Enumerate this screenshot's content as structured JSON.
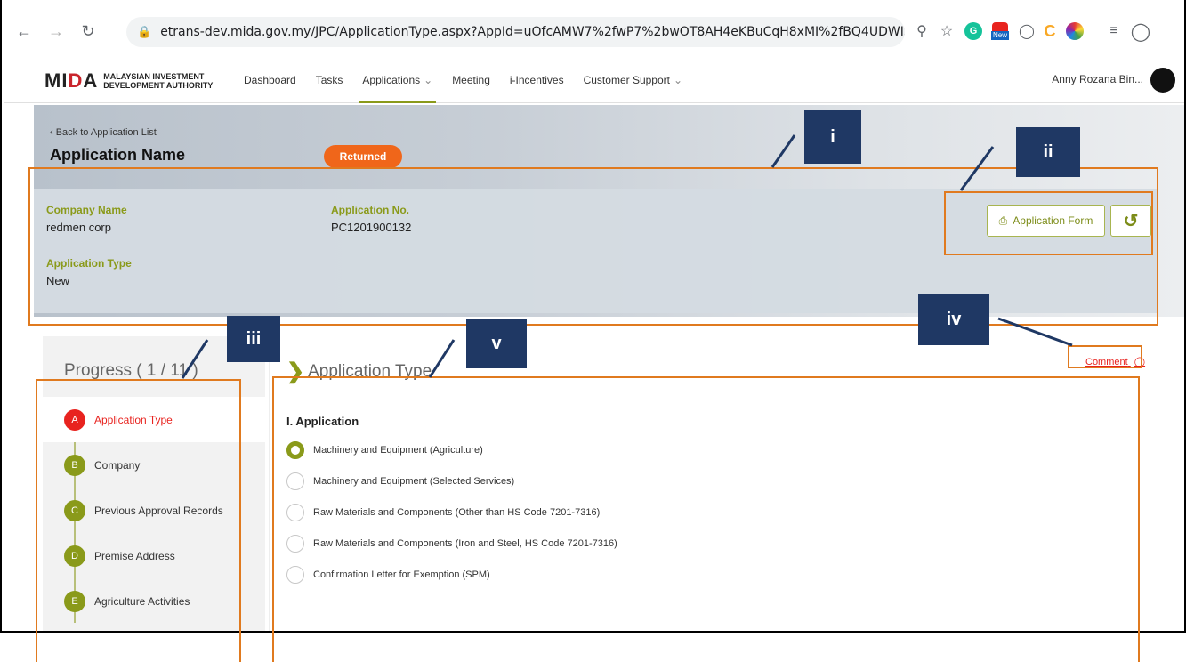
{
  "browser": {
    "url": "etrans-dev.mida.gov.my/JPC/ApplicationType.aspx?AppId=uOfcAMW7%2fwP7%2bwOT8AH4eKBuCqH8xMI%2fBQ4UDWIStrLBWkjIKI12jgd...",
    "nav_icons": [
      "back-arrow-icon",
      "forward-arrow-icon",
      "reload-icon",
      "lock-icon"
    ],
    "right_icons": [
      "zoom-icon",
      "star-icon",
      "grammarly-icon",
      "new-badge-icon",
      "camera-icon",
      "c-extension-icon",
      "color-icon",
      "reading-list-icon",
      "profile-icon"
    ],
    "new_badge": "New"
  },
  "header": {
    "logo_mark": "MIDA",
    "logo_sub_1": "MALAYSIAN INVESTMENT",
    "logo_sub_2": "DEVELOPMENT AUTHORITY",
    "nav": [
      "Dashboard",
      "Tasks",
      "Applications",
      "Meeting",
      "i-Incentives",
      "Customer Support"
    ],
    "username": "Anny Rozana Bin..."
  },
  "banner": {
    "back_link": "‹ Back to Application List",
    "title": "Application Name",
    "status": "Returned",
    "company_label": "Company Name",
    "company_value": "redmen corp",
    "appno_label": "Application No.",
    "appno_value": "PC1201900132",
    "apptype_label": "Application Type",
    "apptype_value": "New",
    "form_button": "Application Form"
  },
  "progress": {
    "title": "Progress ( 1 / 11 )",
    "steps": [
      {
        "letter": "A",
        "label": "Application Type"
      },
      {
        "letter": "B",
        "label": "Company"
      },
      {
        "letter": "C",
        "label": "Previous Approval Records"
      },
      {
        "letter": "D",
        "label": "Premise Address"
      },
      {
        "letter": "E",
        "label": "Agriculture Activities"
      }
    ],
    "active_index": 0
  },
  "section": {
    "title": "Application Type",
    "comment": "Comment",
    "heading": "I. Application",
    "options": [
      "Machinery and Equipment (Agriculture)",
      "Machinery and Equipment (Selected Services)",
      "Raw Materials and Components (Other than HS Code 7201-7316)",
      "Raw Materials and Components (Iron and Steel, HS Code 7201-7316)",
      "Confirmation Letter for Exemption (SPM)"
    ],
    "selected_index": 0
  },
  "annotations": {
    "tags": [
      "i",
      "ii",
      "iii",
      "iv",
      "v"
    ]
  },
  "colors": {
    "accent_olive": "#8a9a1a",
    "status_orange": "#f0661a",
    "active_red": "#e8231f",
    "annotation_orange": "#e07a1f",
    "tag_navy": "#1f3864"
  }
}
